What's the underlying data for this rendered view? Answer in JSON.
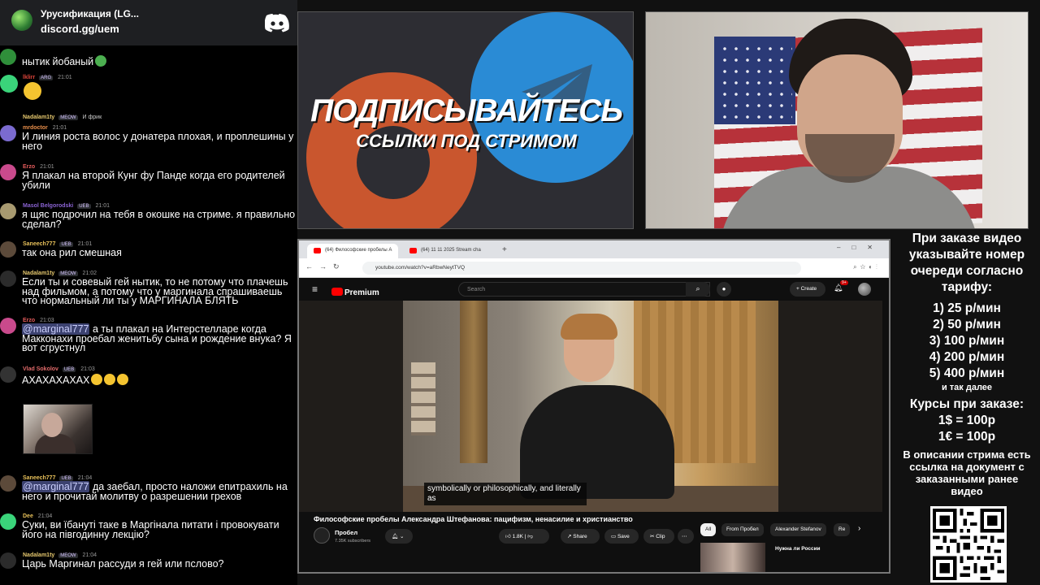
{
  "discord": {
    "server_title": "Урусификация (LG...",
    "invite_link": "discord.gg/uem"
  },
  "chat": {
    "messages": [
      {
        "name": "",
        "name_color": "#ffffff",
        "badge": "",
        "time": "",
        "text": "нытик йобаный"
      },
      {
        "name": "lklirr",
        "name_color": "#e0453b",
        "badge": "ARG",
        "time": "21:01",
        "text": ""
      },
      {
        "name": "Nadalam1ty",
        "name_color": "#e6c86e",
        "badge": "MEOW",
        "time": "",
        "text": "И фрик"
      },
      {
        "name": "mrdoctor",
        "name_color": "#e88e4a",
        "badge": "",
        "time": "21:01",
        "text": "И линия роста волос у донатера плохая, и проплешины у него"
      },
      {
        "name": "Erzo",
        "name_color": "#e55c5c",
        "badge": "",
        "time": "21:01",
        "text": "Я плакал на второй Кунг фу Панде когда его родителей убили"
      },
      {
        "name": "Masol Belgorodski",
        "name_color": "#8a63d2",
        "badge": "UEB",
        "time": "21:01",
        "text": "я щяс подрочил на тебя в окошке на стриме. я правильно сделал?"
      },
      {
        "name": "Saneech777",
        "name_color": "#e8c15a",
        "badge": "UEB",
        "time": "21:01",
        "text": "так она рил смешная"
      },
      {
        "name": "Nadalam1ty",
        "name_color": "#e6c86e",
        "badge": "MEOW",
        "time": "21:02",
        "text": "Если ты и совевый гей нытик, то не потому что плачешь над фильмом, а потому что у маргинала спрашиваешь что нормальный ли ты у МАРГИНАЛА БЛЯТЬ"
      },
      {
        "name": "Erzo",
        "name_color": "#e55c5c",
        "badge": "",
        "time": "21:03",
        "mention": "@marginal777",
        "text": " а ты плакал на Интерстелларе когда Макконахи проебал женитьбу сына и рождение внука? Я вот сгрустнул"
      },
      {
        "name": "Vlad Sokolov",
        "name_color": "#e06a6a",
        "badge": "UEB",
        "time": "21:03",
        "text": "АХАХАХАХАХ"
      },
      {
        "name": "Saneech777",
        "name_color": "#e8c15a",
        "badge": "UEB",
        "time": "21:04",
        "mention": "@marginal777",
        "text": " да заебал, просто наложи епитрахиль на него и прочитай молитву о разрешении грехов"
      },
      {
        "name": "Dee",
        "name_color": "#e8c15a",
        "badge": "",
        "time": "21:04",
        "text": "Суки, ви їбанутi таке в Маргiнала питати i провокувати його на пiвгодинну лекцiю?"
      },
      {
        "name": "Nadalam1ty",
        "name_color": "#e6c86e",
        "badge": "MEOW",
        "time": "21:04",
        "text": "Царь Маргинал рассуди я гей или пслово?"
      }
    ]
  },
  "banner": {
    "title": "ПОДПИСЫВАЙТЕСЬ",
    "subtitle": "ССЫЛКИ ПОД СТРИМОМ"
  },
  "browser": {
    "tabs": [
      {
        "label": "(64) Философские пробелы А"
      },
      {
        "label": "(64) 11 11 2025 Stream cha"
      }
    ],
    "url": "youtube.com/watch?v=aRbwNeytTVQ",
    "youtube": {
      "logo_text": "Premium",
      "search_placeholder": "Search",
      "create_label": "Create",
      "notification_count": "9+",
      "caption": "symbolically or philosophically, and literally as",
      "video_title": "Философские пробелы Александра Штефанова: пацифизм, ненасилие и христианство",
      "channel_name": "Пробел",
      "subscribers": "7.35K subscribers",
      "likes": "1.8K",
      "share_label": "Share",
      "save_label": "Save",
      "clip_label": "Clip",
      "chips": [
        "All",
        "From Пробел",
        "Alexander Stefanov",
        "Re"
      ],
      "recommended_title": "Нужна ли России"
    }
  },
  "info_panel": {
    "order_text": "При заказе видео указывайте номер очереди согласно тарифу:",
    "tariffs": [
      "1) 25 р/мин",
      "2) 50 р/мин",
      "3) 100 р/мин",
      "4) 200 р/мин",
      "5) 400 р/мин"
    ],
    "etc": "и так далее",
    "courses_title": "Курсы при заказе:",
    "rate_usd": "1$ = 100р",
    "rate_eur": "1€ = 100р",
    "description_text": "В описании стрима есть ссылка на документ с заказанными ранее видео"
  }
}
